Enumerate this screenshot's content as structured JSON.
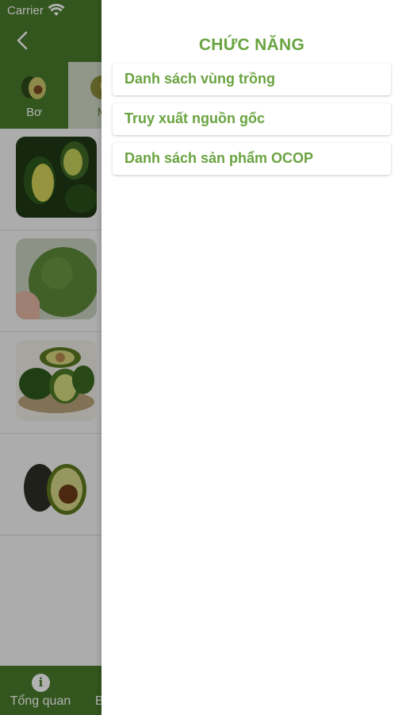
{
  "status_bar": {
    "carrier": "Carrier"
  },
  "background_app": {
    "categories": [
      {
        "label": "Bơ",
        "active": false
      },
      {
        "label": "M",
        "active": true
      }
    ],
    "bottom_nav": [
      {
        "label": "Tổng quan",
        "icon": "info-icon"
      },
      {
        "label": "B",
        "icon": ""
      }
    ]
  },
  "drawer": {
    "title": "CHỨC NĂNG",
    "items": [
      {
        "label": "Danh sách vùng trồng"
      },
      {
        "label": "Truy xuất nguồn gốc"
      },
      {
        "label": "Danh sách sản phẩm OCOP"
      }
    ]
  },
  "colors": {
    "header_green": "#4a7a2c",
    "accent_green": "#6aa441"
  }
}
